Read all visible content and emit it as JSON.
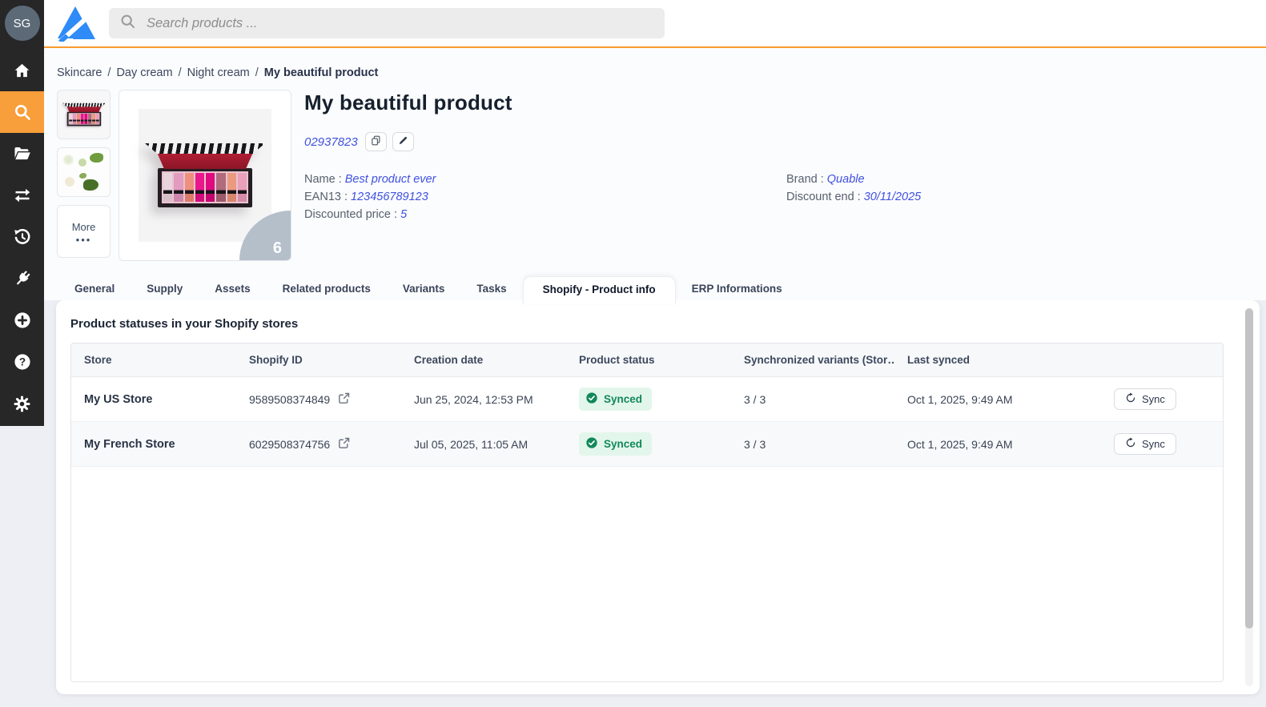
{
  "sidebar": {
    "avatar_initials": "SG",
    "icons_top": [
      "home-icon",
      "search-icon",
      "folder-open-icon",
      "transfer-arrows-icon",
      "history-icon"
    ],
    "active_item": "search",
    "icons_bottom": [
      "plug-icon",
      "plus-circle-icon",
      "help-circle-icon",
      "gear-icon"
    ],
    "active_color": "#f89e3a"
  },
  "topbar": {
    "search_placeholder": "Search products ..."
  },
  "breadcrumb": {
    "items": [
      "Skincare",
      "Day cream",
      "Night cream",
      "My beautiful product"
    ]
  },
  "product": {
    "title": "My beautiful product",
    "id": "02937823",
    "more_label": "More",
    "more_dots": "•••",
    "image_count": "6",
    "fields_left": [
      {
        "label": "Name",
        "value": "Best product ever"
      },
      {
        "label": "EAN13",
        "value": "123456789123"
      },
      {
        "label": "Discounted price",
        "value": "5"
      }
    ],
    "fields_right": [
      {
        "label": "Brand",
        "value": "Quable"
      },
      {
        "label": "Discount end",
        "value": "30/11/2025"
      }
    ]
  },
  "tabs": [
    {
      "label": "General",
      "active": false
    },
    {
      "label": "Supply",
      "active": false
    },
    {
      "label": "Assets",
      "active": false
    },
    {
      "label": "Related products",
      "active": false
    },
    {
      "label": "Variants",
      "active": false
    },
    {
      "label": "Tasks",
      "active": false
    },
    {
      "label": "Shopify - Product info",
      "active": true
    },
    {
      "label": "ERP Informations",
      "active": false
    }
  ],
  "shopify_panel": {
    "heading": "Product statuses in your Shopify stores",
    "table": {
      "columns": [
        "Store",
        "Shopify ID",
        "Creation date",
        "Product status",
        "Synchronized variants (Stor…",
        "Last synced"
      ],
      "rows": [
        {
          "store": "My US Store",
          "shopify_id": "9589508374849",
          "creation_date": "Jun 25, 2024, 12:53 PM",
          "status": "Synced",
          "variants": "3 / 3",
          "last_synced": "Oct 1, 2025, 9:49 AM",
          "action": "Sync"
        },
        {
          "store": "My French Store",
          "shopify_id": "6029508374756",
          "creation_date": "Jul 05, 2025, 11:05 AM",
          "status": "Synced",
          "variants": "3 / 3",
          "last_synced": "Oct 1, 2025, 9:49 AM",
          "action": "Sync"
        }
      ]
    }
  },
  "colors": {
    "accent_orange": "#f89e3a",
    "link_blue": "#3f51e0",
    "status_green": "#12885a",
    "status_green_bg": "#e3f6ec",
    "sidebar_bg": "#272727",
    "logo_blue": "#2e8bf7"
  }
}
